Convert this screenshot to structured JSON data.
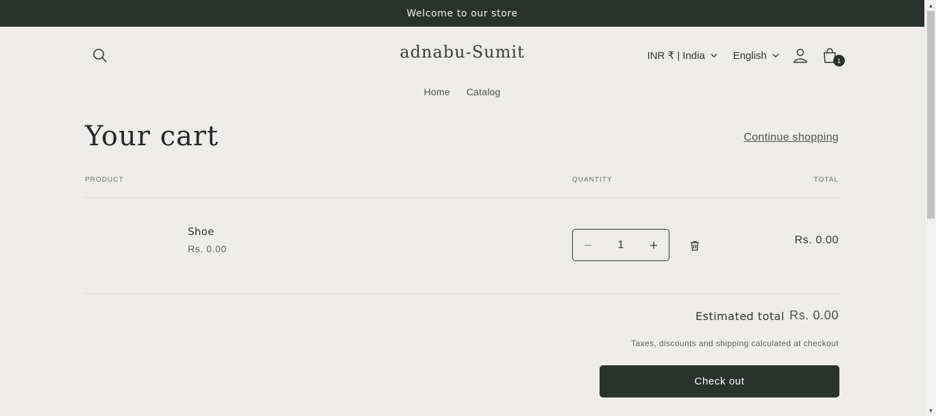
{
  "announcement": {
    "text": "Welcome to our store"
  },
  "header": {
    "logo": "adnabu-Sumit",
    "country_selector": "INR ₹ | India",
    "language_selector": "English",
    "cart_count": "1"
  },
  "nav": {
    "items": [
      "Home",
      "Catalog"
    ]
  },
  "cart": {
    "title": "Your cart",
    "continue_shopping": "Continue shopping",
    "columns": {
      "product": "PRODUCT",
      "quantity": "QUANTITY",
      "total": "TOTAL"
    },
    "items": [
      {
        "name": "Shoe",
        "price": "Rs. 0.00",
        "quantity": "1",
        "line_total": "Rs. 0.00"
      }
    ],
    "estimated_total_label": "Estimated total",
    "estimated_total_value": "Rs. 0.00",
    "tax_note": "Taxes, discounts and shipping calculated at checkout",
    "checkout_label": "Check out"
  },
  "icons": [
    "search-icon",
    "chevron-down-icon",
    "account-icon",
    "cart-icon",
    "minus-icon",
    "plus-icon",
    "trash-icon"
  ],
  "colors": {
    "dark": "#2b312d",
    "background": "#efedea"
  }
}
